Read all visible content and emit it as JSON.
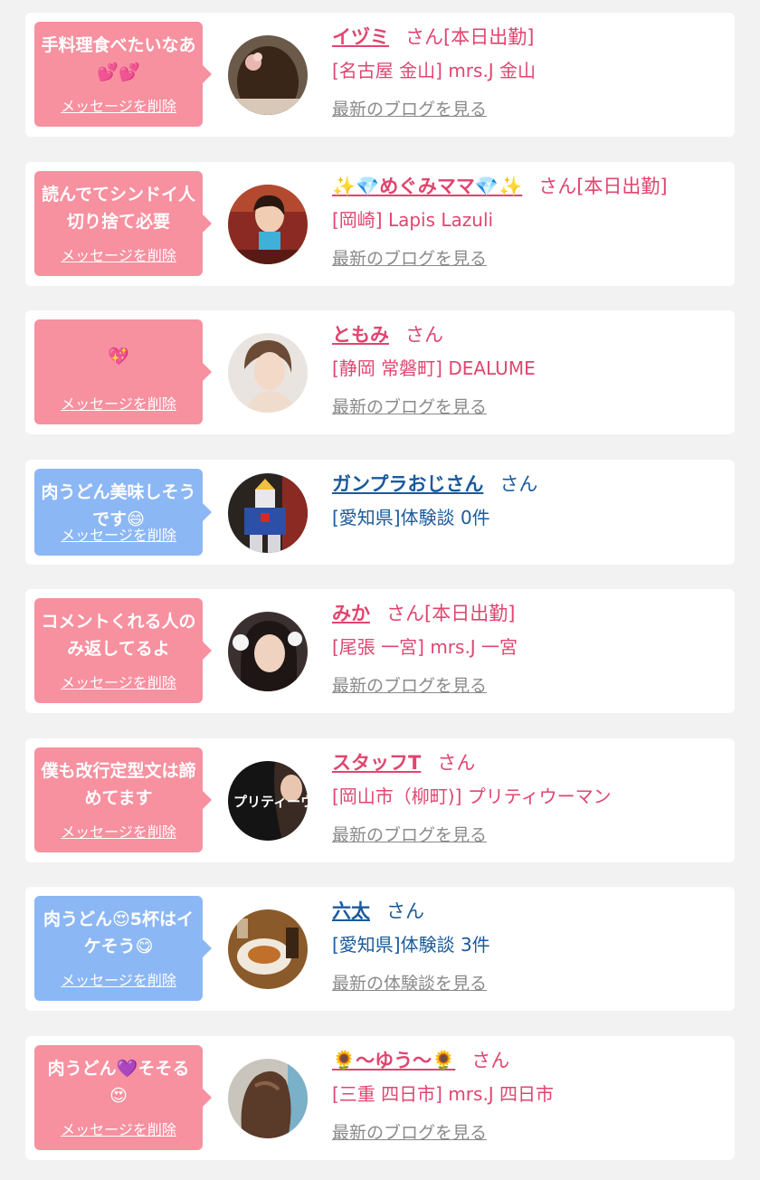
{
  "colors": {
    "pink_bubble": "#f7909f",
    "blue_bubble": "#8cb7f5",
    "pink_text": "#e0456f",
    "blue_text": "#1a5a9c",
    "link_gray": "#8a8a8a"
  },
  "messages": [
    {
      "bubble_color": "pink",
      "message": "手料理食べたいなあ💕💕",
      "delete_label": "メッセージを削除",
      "name": "イヅミ",
      "suffix": "さん[本日出勤]",
      "shop": "[名古屋 金山] mrs.J 金山",
      "link": "最新のブログを見る",
      "avatar_icon": "avatar-hair-back-icon"
    },
    {
      "bubble_color": "pink",
      "message": "読んでてシンドイ人切り捨て必要",
      "delete_label": "メッセージを削除",
      "name": "✨💎めぐみママ💎✨",
      "suffix": "さん[本日出勤]",
      "shop": "[岡崎] Lapis Lazuli",
      "link": "最新のブログを見る",
      "avatar_icon": "avatar-woman-icon"
    },
    {
      "bubble_color": "pink",
      "message": "💖",
      "delete_label": "メッセージを削除",
      "name": "ともみ",
      "suffix": "さん",
      "shop": "[静岡 常磐町] DEALUME",
      "link": "最新のブログを見る",
      "avatar_icon": "avatar-woman-icon"
    },
    {
      "bubble_color": "blue",
      "message": "肉うどん美味しそうです😄",
      "delete_label": "メッセージを削除",
      "name": "ガンプラおじさん",
      "suffix": "さん",
      "shop": "[愛知県]体験談 0件",
      "link": "",
      "avatar_icon": "avatar-robot-icon"
    },
    {
      "bubble_color": "pink",
      "message": "コメントくれる人のみ返してるよ",
      "delete_label": "メッセージを削除",
      "name": "みか",
      "suffix": "さん[本日出勤]",
      "shop": "[尾張 一宮] mrs.J 一宮",
      "link": "最新のブログを見る",
      "avatar_icon": "avatar-woman-icon"
    },
    {
      "bubble_color": "pink",
      "message": "僕も改行定型文は諦めてます",
      "delete_label": "メッセージを削除",
      "name": "スタッフT",
      "suffix": "さん",
      "shop": "[岡山市（柳町)] プリティウーマン",
      "link": "最新のブログを見る",
      "avatar_icon": "avatar-shop-logo-icon",
      "avatar_logo_text": "プリティーウーマ"
    },
    {
      "bubble_color": "blue",
      "message": "肉うどん😍5杯はイケそう😋",
      "delete_label": "メッセージを削除",
      "name": "六太",
      "suffix": "さん",
      "shop": "[愛知県]体験談 3件",
      "link": "最新の体験談を見る",
      "avatar_icon": "avatar-food-icon"
    },
    {
      "bubble_color": "pink",
      "message": "肉うどん💜そそる😍",
      "delete_label": "メッセージを削除",
      "name": "🌻〜ゆう〜🌻",
      "suffix": "さん",
      "shop": "[三重 四日市] mrs.J 四日市",
      "link": "最新のブログを見る",
      "avatar_icon": "avatar-hair-back-icon"
    }
  ]
}
